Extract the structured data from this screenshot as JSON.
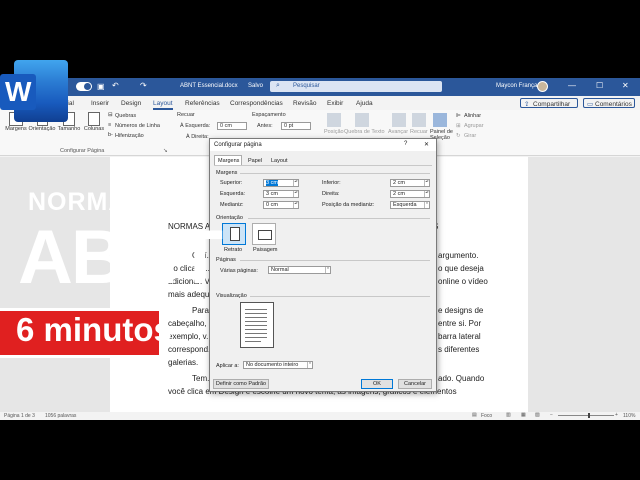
{
  "titlebar": {
    "doc_name": "ABNT Essencial.docx",
    "saved": "Salvo",
    "search_placeholder": "Pesquisar",
    "user": "Maycon França"
  },
  "tabs": [
    "...ial",
    "Inserir",
    "Design",
    "Layout",
    "Referências",
    "Correspondências",
    "Revisão",
    "Exibir",
    "Ajuda"
  ],
  "active_tab": "Layout",
  "ribbon": {
    "share": "Compartilhar",
    "comments": "Comentários",
    "margins": "Margens",
    "orientation": "Orientação",
    "size": "Tamanho",
    "columns": "Colunas",
    "breaks": "Quebras",
    "line_numbers": "Números de Linha",
    "hyphenation": "Hifenização",
    "group_page_setup": "Configurar Página",
    "indent_label": "Recuar",
    "spacing_label": "Espaçamento",
    "indent_left": "À Esquerda:",
    "indent_left_val": "0 cm",
    "indent_right": "À Direita:",
    "spacing_before": "Antes:",
    "spacing_before_val": "0 pt",
    "arrange": [
      "Posição",
      "Quebra de Texto",
      "Avançar",
      "Recuar",
      "Painel de Seleção"
    ],
    "align": "Alinhar",
    "group": "Agrupar",
    "rotate": "Girar"
  },
  "document": {
    "lines": [
      "NORMAS A...",
      "O ví...",
      "Ao clicar e...",
      "adicionar. V...",
      "mais adequ...",
      "Para ...",
      "cabeçalho, ...",
      "exemplo, v...",
      "correspond...",
      "galerias.",
      "Tem...",
      "você clica em Design e escolhe um novo tema, as imagens, gráficos e elementos"
    ],
    "right_fragments": [
      "S",
      "argumento.",
      "o que deseja",
      "online o vídeo",
      "e designs de",
      "entre si. Por",
      "barra lateral",
      "s diferentes",
      "ado. Quando"
    ]
  },
  "statusbar": {
    "page": "Página 1 de 3",
    "words": "1056 palavras",
    "focus": "Foco",
    "zoom": "110%"
  },
  "dialog": {
    "title": "Configurar página",
    "help": "?",
    "close": "✕",
    "tabs": [
      "Margens",
      "Papel",
      "Layout"
    ],
    "section_margins": "Margens",
    "superior_label": "Superior:",
    "superior_val": "3 cm",
    "inferior_label": "Inferior:",
    "inferior_val": "2 cm",
    "esquerda_label": "Esquerda:",
    "esquerda_val": "3 cm",
    "direita_label": "Direita:",
    "direita_val": "2 cm",
    "medianiz_label": "Medianiz:",
    "medianiz_val": "0 cm",
    "pos_medianiz_label": "Posição da medianiz:",
    "pos_medianiz_val": "Esquerda",
    "section_orientation": "Orientação",
    "portrait": "Retrato",
    "landscape": "Paisagem",
    "section_pages": "Páginas",
    "multiple_pages_label": "Várias páginas:",
    "multiple_pages_val": "Normal",
    "section_preview": "Visualização",
    "apply_label": "Aplicar a:",
    "apply_val": "No documento inteiro",
    "default_button": "Definir como Padrão",
    "ok_button": "OK",
    "cancel_button": "Cancelar"
  },
  "overlay": {
    "normas": "NORMAS",
    "abnt": "ABNT",
    "duration": "6 minutos",
    "word_logo_letter": "W"
  },
  "colors": {
    "word_blue": "#2b579a",
    "accent_red": "#e02020",
    "background": "#000000"
  }
}
